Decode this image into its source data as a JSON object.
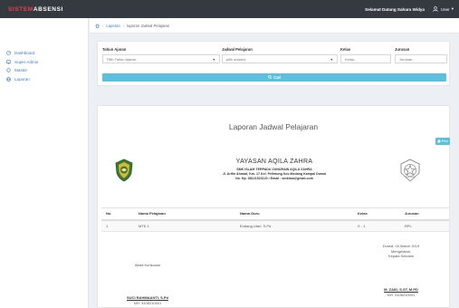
{
  "app": {
    "brand_part1": "SISTEM",
    "brand_part2": "ABSENSI",
    "welcome": "Selamat Datang Sahara Widya",
    "user_menu": "User"
  },
  "sidebar": {
    "items": [
      {
        "label": "Dashboard",
        "icon": "dashboard-icon"
      },
      {
        "label": "Super Admin",
        "icon": "monitor-icon"
      },
      {
        "label": "Master",
        "icon": "circle-icon"
      },
      {
        "label": "Laporan",
        "icon": "globe-icon"
      }
    ]
  },
  "breadcrumb": {
    "home": "Laporan",
    "current": "laporan Jadwal Pelajaran"
  },
  "filter": {
    "tahun_label": "Tahun Ajaran",
    "tahun_value": "Pilih Tahun Ajaran..",
    "jadwal_label": "Jadwal Pelajaran",
    "jadwal_value": "pilih subject..",
    "kelas_label": "Kelas",
    "kelas_placeholder": "Kelas...",
    "jurusan_label": "Jurusan",
    "jurusan_placeholder": "Jurusan...",
    "search_button": "Cari"
  },
  "report": {
    "title": "Laporan Jadwal Pelajaran",
    "print_button": "Print",
    "org_name": "YAYASAN AQILA ZAHRA",
    "school": "SMK ISLAM TERPADU ZUNURAIN AQILA ZAHRA",
    "address": "Jl. Arifin Ahmad, Km. 17 Kel. Pelintung Kec.Medang Kampai Dumai",
    "contact": "No. Hp. 08121523120 / Email : smkitza@gmail.com",
    "table": {
      "headers": [
        "No.",
        "Nama Pelajaran",
        "Nama Guru",
        "Kelas",
        "Jurusan"
      ],
      "rows": [
        [
          "1",
          "MTK 1",
          "Endang Utari. S.Pd",
          "X - 1",
          "RPL"
        ]
      ]
    },
    "left_sign": {
      "role": "Wakil Kurikulum",
      "name": "SUCI RAHMAANTI, S.Pd",
      "nip": "NIY. 4106210001"
    },
    "right_sign": {
      "date": "Dumai, 04 March 2019",
      "know": "Mengetahui,",
      "role": "Kepala Sekolah",
      "name": "M. ZAID, S.ST, M.PD",
      "nip": "NIY. 4106210001"
    }
  },
  "colors": {
    "topbar": "#343a40",
    "brand_accent": "#e8414b",
    "sidebar_link": "#3d7ec4",
    "button": "#5bc0de"
  }
}
